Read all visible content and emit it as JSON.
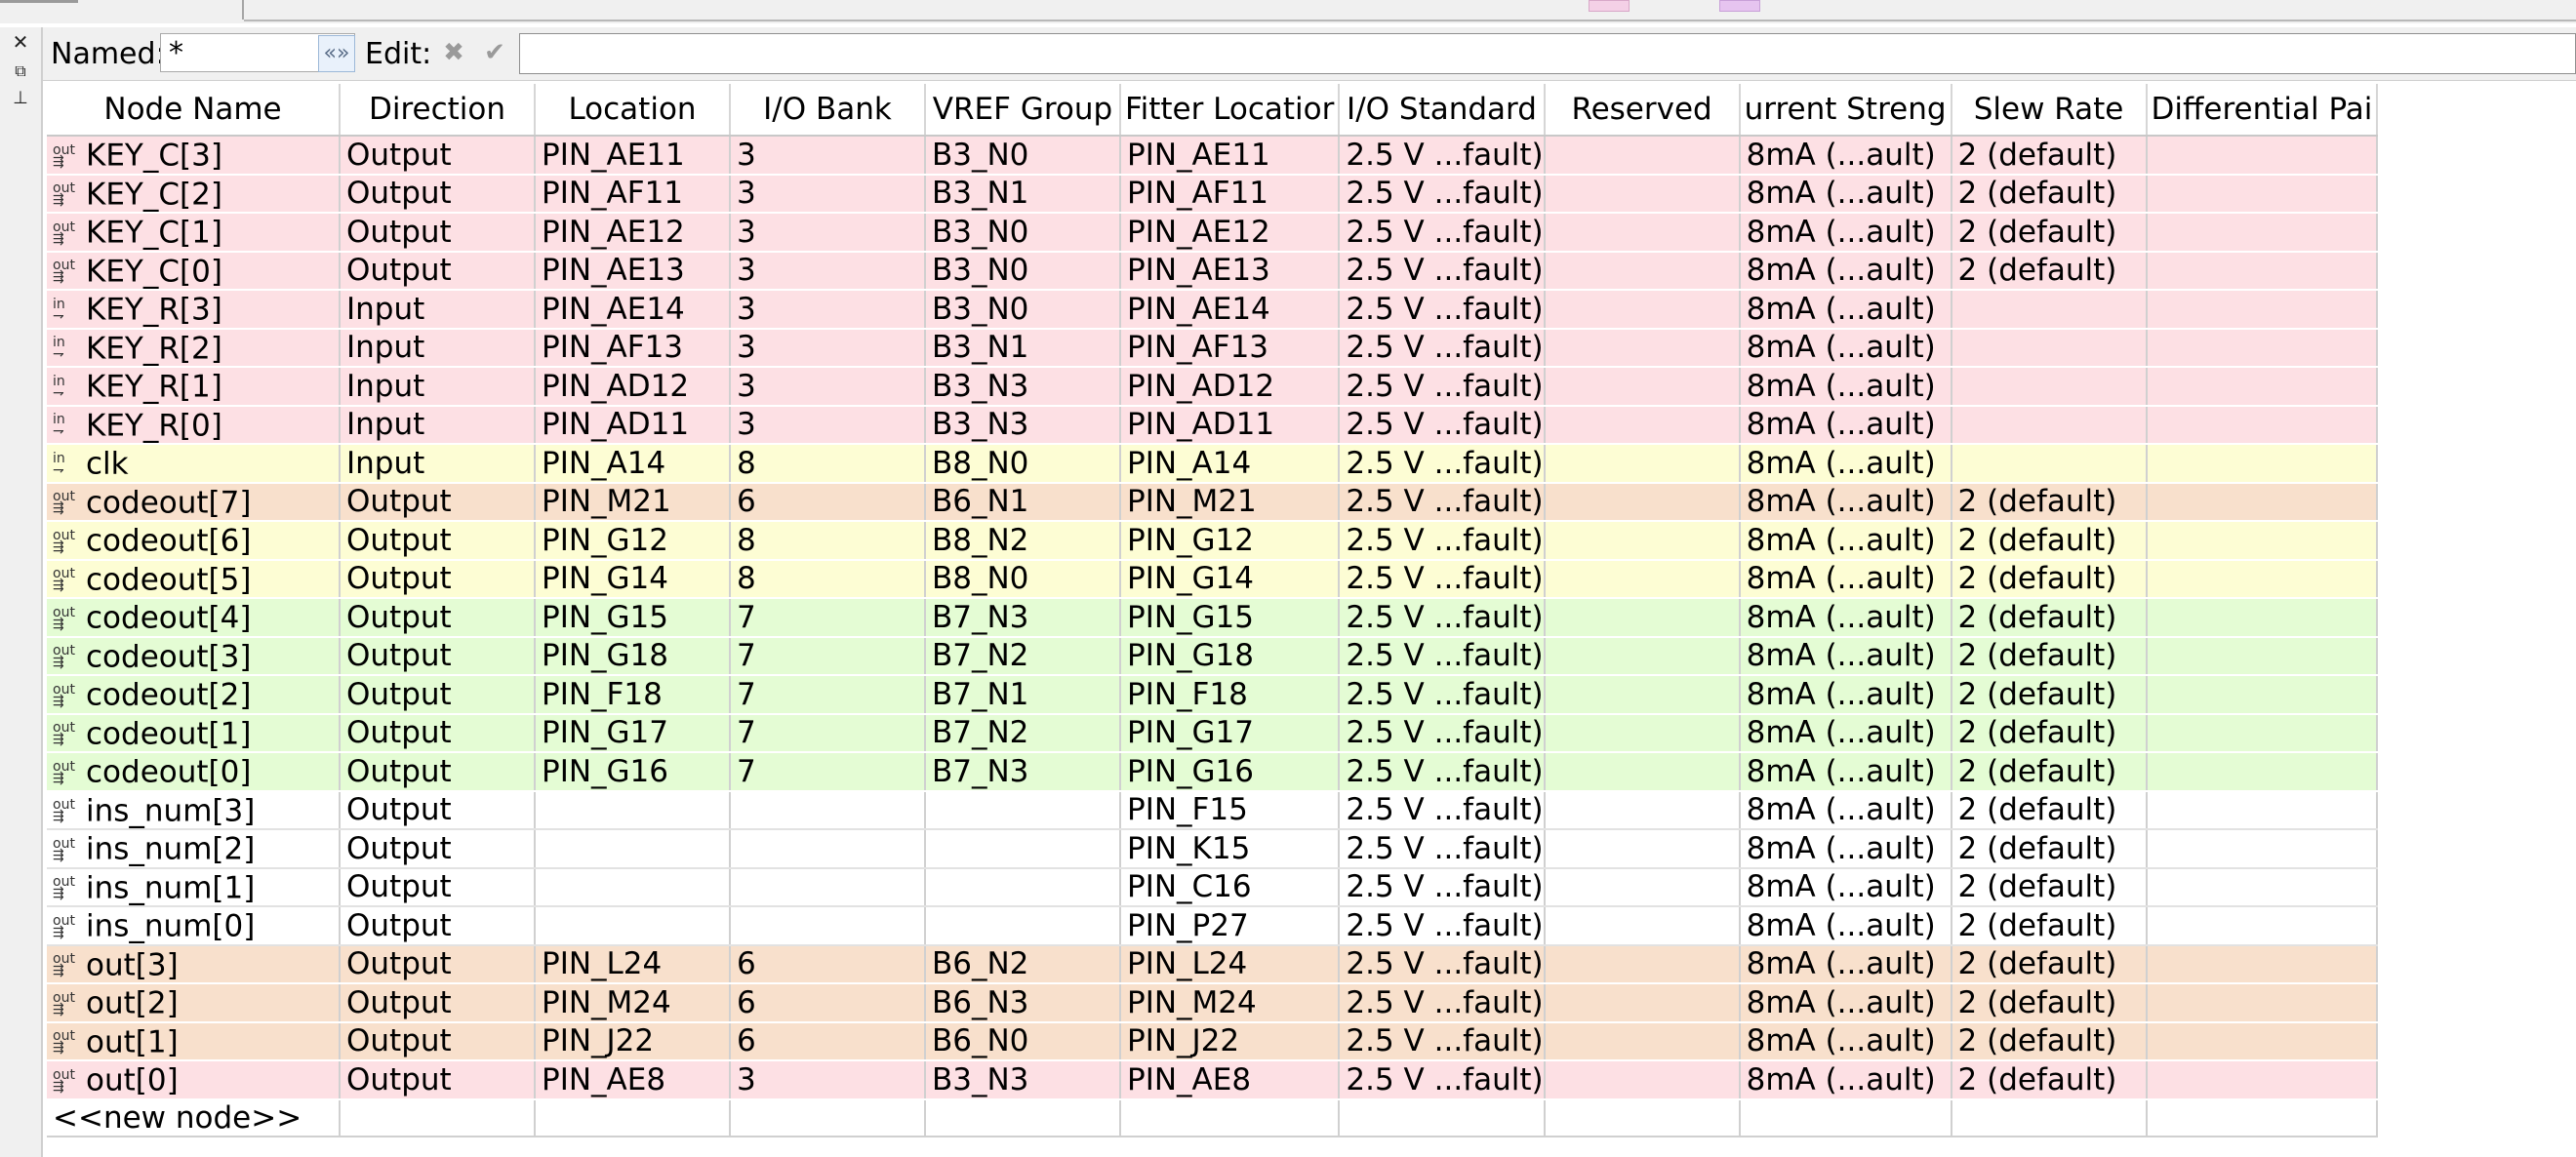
{
  "toolbar": {
    "named_label": "Named:",
    "named_value": "*",
    "edit_label": "Edit:"
  },
  "columns": [
    "Node Name",
    "Direction",
    "Location",
    "I/O Bank",
    "VREF Group",
    "Fitter Location",
    "I/O Standard",
    "Reserved",
    "Current Strength",
    "Slew Rate",
    "Differential Pair"
  ],
  "column_display": [
    "Node Name",
    "Direction",
    "Location",
    "I/O Bank",
    "VREF Group",
    "Fitter Locatior",
    "I/O Standard",
    "Reserved",
    "urrent Streng",
    "Slew Rate",
    "Differential Pai"
  ],
  "rows": [
    {
      "name": "KEY_C[3]",
      "dir": "Output",
      "loc": "PIN_AE11",
      "bank": "3",
      "vref": "B3_N0",
      "fitter": "PIN_AE11",
      "std": "2.5 V ...fault)",
      "res": "",
      "cur": "8mA (...ault)",
      "slew": "2 (default)",
      "diff": "",
      "color": "pink"
    },
    {
      "name": "KEY_C[2]",
      "dir": "Output",
      "loc": "PIN_AF11",
      "bank": "3",
      "vref": "B3_N1",
      "fitter": "PIN_AF11",
      "std": "2.5 V ...fault)",
      "res": "",
      "cur": "8mA (...ault)",
      "slew": "2 (default)",
      "diff": "",
      "color": "pink"
    },
    {
      "name": "KEY_C[1]",
      "dir": "Output",
      "loc": "PIN_AE12",
      "bank": "3",
      "vref": "B3_N0",
      "fitter": "PIN_AE12",
      "std": "2.5 V ...fault)",
      "res": "",
      "cur": "8mA (...ault)",
      "slew": "2 (default)",
      "diff": "",
      "color": "pink"
    },
    {
      "name": "KEY_C[0]",
      "dir": "Output",
      "loc": "PIN_AE13",
      "bank": "3",
      "vref": "B3_N0",
      "fitter": "PIN_AE13",
      "std": "2.5 V ...fault)",
      "res": "",
      "cur": "8mA (...ault)",
      "slew": "2 (default)",
      "diff": "",
      "color": "pink"
    },
    {
      "name": "KEY_R[3]",
      "dir": "Input",
      "loc": "PIN_AE14",
      "bank": "3",
      "vref": "B3_N0",
      "fitter": "PIN_AE14",
      "std": "2.5 V ...fault)",
      "res": "",
      "cur": "8mA (...ault)",
      "slew": "",
      "diff": "",
      "color": "pink"
    },
    {
      "name": "KEY_R[2]",
      "dir": "Input",
      "loc": "PIN_AF13",
      "bank": "3",
      "vref": "B3_N1",
      "fitter": "PIN_AF13",
      "std": "2.5 V ...fault)",
      "res": "",
      "cur": "8mA (...ault)",
      "slew": "",
      "diff": "",
      "color": "pink"
    },
    {
      "name": "KEY_R[1]",
      "dir": "Input",
      "loc": "PIN_AD12",
      "bank": "3",
      "vref": "B3_N3",
      "fitter": "PIN_AD12",
      "std": "2.5 V ...fault)",
      "res": "",
      "cur": "8mA (...ault)",
      "slew": "",
      "diff": "",
      "color": "pink"
    },
    {
      "name": "KEY_R[0]",
      "dir": "Input",
      "loc": "PIN_AD11",
      "bank": "3",
      "vref": "B3_N3",
      "fitter": "PIN_AD11",
      "std": "2.5 V ...fault)",
      "res": "",
      "cur": "8mA (...ault)",
      "slew": "",
      "diff": "",
      "color": "pink"
    },
    {
      "name": "clk",
      "dir": "Input",
      "loc": "PIN_A14",
      "bank": "8",
      "vref": "B8_N0",
      "fitter": "PIN_A14",
      "std": "2.5 V ...fault)",
      "res": "",
      "cur": "8mA (...ault)",
      "slew": "",
      "diff": "",
      "color": "yellow"
    },
    {
      "name": "codeout[7]",
      "dir": "Output",
      "loc": "PIN_M21",
      "bank": "6",
      "vref": "B6_N1",
      "fitter": "PIN_M21",
      "std": "2.5 V ...fault)",
      "res": "",
      "cur": "8mA (...ault)",
      "slew": "2 (default)",
      "diff": "",
      "color": "tan"
    },
    {
      "name": "codeout[6]",
      "dir": "Output",
      "loc": "PIN_G12",
      "bank": "8",
      "vref": "B8_N2",
      "fitter": "PIN_G12",
      "std": "2.5 V ...fault)",
      "res": "",
      "cur": "8mA (...ault)",
      "slew": "2 (default)",
      "diff": "",
      "color": "yellow"
    },
    {
      "name": "codeout[5]",
      "dir": "Output",
      "loc": "PIN_G14",
      "bank": "8",
      "vref": "B8_N0",
      "fitter": "PIN_G14",
      "std": "2.5 V ...fault)",
      "res": "",
      "cur": "8mA (...ault)",
      "slew": "2 (default)",
      "diff": "",
      "color": "yellow"
    },
    {
      "name": "codeout[4]",
      "dir": "Output",
      "loc": "PIN_G15",
      "bank": "7",
      "vref": "B7_N3",
      "fitter": "PIN_G15",
      "std": "2.5 V ...fault)",
      "res": "",
      "cur": "8mA (...ault)",
      "slew": "2 (default)",
      "diff": "",
      "color": "green"
    },
    {
      "name": "codeout[3]",
      "dir": "Output",
      "loc": "PIN_G18",
      "bank": "7",
      "vref": "B7_N2",
      "fitter": "PIN_G18",
      "std": "2.5 V ...fault)",
      "res": "",
      "cur": "8mA (...ault)",
      "slew": "2 (default)",
      "diff": "",
      "color": "green"
    },
    {
      "name": "codeout[2]",
      "dir": "Output",
      "loc": "PIN_F18",
      "bank": "7",
      "vref": "B7_N1",
      "fitter": "PIN_F18",
      "std": "2.5 V ...fault)",
      "res": "",
      "cur": "8mA (...ault)",
      "slew": "2 (default)",
      "diff": "",
      "color": "green"
    },
    {
      "name": "codeout[1]",
      "dir": "Output",
      "loc": "PIN_G17",
      "bank": "7",
      "vref": "B7_N2",
      "fitter": "PIN_G17",
      "std": "2.5 V ...fault)",
      "res": "",
      "cur": "8mA (...ault)",
      "slew": "2 (default)",
      "diff": "",
      "color": "green"
    },
    {
      "name": "codeout[0]",
      "dir": "Output",
      "loc": "PIN_G16",
      "bank": "7",
      "vref": "B7_N3",
      "fitter": "PIN_G16",
      "std": "2.5 V ...fault)",
      "res": "",
      "cur": "8mA (...ault)",
      "slew": "2 (default)",
      "diff": "",
      "color": "green"
    },
    {
      "name": "ins_num[3]",
      "dir": "Output",
      "loc": "",
      "bank": "",
      "vref": "",
      "fitter": "PIN_F15",
      "std": "2.5 V ...fault)",
      "res": "",
      "cur": "8mA (...ault)",
      "slew": "2 (default)",
      "diff": "",
      "color": "white"
    },
    {
      "name": "ins_num[2]",
      "dir": "Output",
      "loc": "",
      "bank": "",
      "vref": "",
      "fitter": "PIN_K15",
      "std": "2.5 V ...fault)",
      "res": "",
      "cur": "8mA (...ault)",
      "slew": "2 (default)",
      "diff": "",
      "color": "white"
    },
    {
      "name": "ins_num[1]",
      "dir": "Output",
      "loc": "",
      "bank": "",
      "vref": "",
      "fitter": "PIN_C16",
      "std": "2.5 V ...fault)",
      "res": "",
      "cur": "8mA (...ault)",
      "slew": "2 (default)",
      "diff": "",
      "color": "white"
    },
    {
      "name": "ins_num[0]",
      "dir": "Output",
      "loc": "",
      "bank": "",
      "vref": "",
      "fitter": "PIN_P27",
      "std": "2.5 V ...fault)",
      "res": "",
      "cur": "8mA (...ault)",
      "slew": "2 (default)",
      "diff": "",
      "color": "white"
    },
    {
      "name": "out[3]",
      "dir": "Output",
      "loc": "PIN_L24",
      "bank": "6",
      "vref": "B6_N2",
      "fitter": "PIN_L24",
      "std": "2.5 V ...fault)",
      "res": "",
      "cur": "8mA (...ault)",
      "slew": "2 (default)",
      "diff": "",
      "color": "tan"
    },
    {
      "name": "out[2]",
      "dir": "Output",
      "loc": "PIN_M24",
      "bank": "6",
      "vref": "B6_N3",
      "fitter": "PIN_M24",
      "std": "2.5 V ...fault)",
      "res": "",
      "cur": "8mA (...ault)",
      "slew": "2 (default)",
      "diff": "",
      "color": "tan"
    },
    {
      "name": "out[1]",
      "dir": "Output",
      "loc": "PIN_J22",
      "bank": "6",
      "vref": "B6_N0",
      "fitter": "PIN_J22",
      "std": "2.5 V ...fault)",
      "res": "",
      "cur": "8mA (...ault)",
      "slew": "2 (default)",
      "diff": "",
      "color": "tan"
    },
    {
      "name": "out[0]",
      "dir": "Output",
      "loc": "PIN_AE8",
      "bank": "3",
      "vref": "B3_N3",
      "fitter": "PIN_AE8",
      "std": "2.5 V ...fault)",
      "res": "",
      "cur": "8mA (...ault)",
      "slew": "2 (default)",
      "diff": "",
      "color": "pink"
    }
  ],
  "new_node_label": "<<new node>>",
  "icons": {
    "output": "output-pin-icon",
    "input": "input-pin-icon",
    "output_text": "out",
    "input_text": "in"
  },
  "colors": {
    "pink": "#fde0e4",
    "yellow": "#fdfdd4",
    "tan": "#f8e0cc",
    "green": "#e4fcd4"
  }
}
